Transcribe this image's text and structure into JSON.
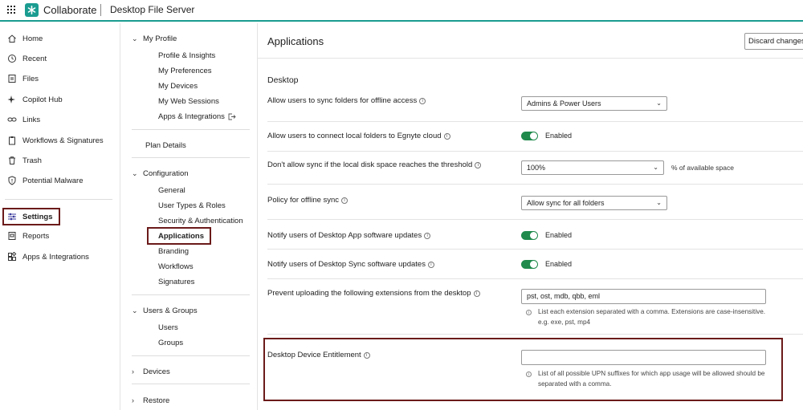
{
  "topbar": {
    "brand": "Collaborate",
    "app_title": "Desktop File Server"
  },
  "leftnav": {
    "items": [
      {
        "label": "Home",
        "icon": "home-icon"
      },
      {
        "label": "Recent",
        "icon": "clock-icon"
      },
      {
        "label": "Files",
        "icon": "file-icon"
      },
      {
        "label": "Copilot Hub",
        "icon": "sparkle-icon"
      },
      {
        "label": "Links",
        "icon": "link-icon"
      },
      {
        "label": "Workflows & Signatures",
        "icon": "clipboard-icon"
      },
      {
        "label": "Trash",
        "icon": "trash-icon"
      },
      {
        "label": "Potential Malware",
        "icon": "shield-icon"
      },
      {
        "label": "Settings",
        "icon": "sliders-icon"
      },
      {
        "label": "Reports",
        "icon": "report-icon"
      },
      {
        "label": "Apps & Integrations",
        "icon": "apps-icon"
      }
    ]
  },
  "subnav": {
    "my_profile": {
      "title": "My Profile",
      "items": [
        "Profile & Insights",
        "My Preferences",
        "My Devices",
        "My Web Sessions",
        "Apps & Integrations"
      ]
    },
    "plan_details": "Plan Details",
    "configuration": {
      "title": "Configuration",
      "items": [
        "General",
        "User Types & Roles",
        "Security & Authentication",
        "Applications",
        "Branding",
        "Workflows",
        "Signatures"
      ]
    },
    "users_groups": {
      "title": "Users & Groups",
      "items": [
        "Users",
        "Groups"
      ]
    },
    "devices": "Devices",
    "restore": "Restore"
  },
  "main": {
    "title": "Applications",
    "discard_label": "Discard changes",
    "section_title": "Desktop",
    "rows": {
      "sync_offline": {
        "label": "Allow users to sync folders for offline access",
        "value": "Admins & Power Users"
      },
      "connect_local": {
        "label": "Allow users to connect local folders to Egnyte cloud",
        "value": "Enabled"
      },
      "disk_threshold": {
        "label": "Don't allow sync if the local disk space reaches the threshold",
        "value": "100%",
        "suffix": "% of available space"
      },
      "offline_policy": {
        "label": "Policy for offline sync",
        "value": "Allow sync for all folders"
      },
      "notify_app": {
        "label": "Notify users of Desktop App software updates",
        "value": "Enabled"
      },
      "notify_sync": {
        "label": "Notify users of Desktop Sync software updates",
        "value": "Enabled"
      },
      "prevent_ext": {
        "label": "Prevent uploading the following extensions from the desktop",
        "value": "pst, ost, mdb, qbb, eml",
        "help": "List each extension separated with a comma. Extensions are case-insensitive. e.g. exe, pst, mp4"
      },
      "entitlement": {
        "label": "Desktop Device Entitlement",
        "value": "",
        "help": "List of all possible UPN suffixes for which app usage will be allowed should be separated with a comma."
      }
    }
  },
  "colors": {
    "accent": "#1b9c91",
    "toggle_on": "#1f8a4c",
    "highlight_box": "#6b1a1a"
  }
}
